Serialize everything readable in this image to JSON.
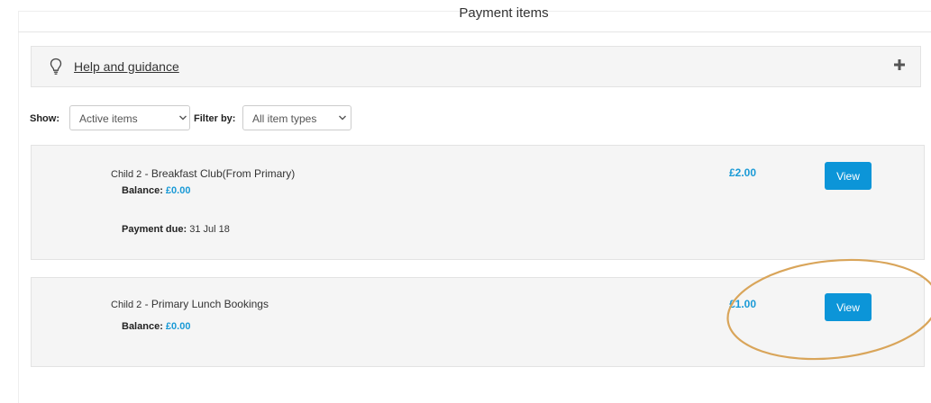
{
  "page": {
    "title": "Payment items"
  },
  "help": {
    "icon": "lightbulb-icon",
    "label": "Help and guidance",
    "expand_icon": "plus-icon"
  },
  "filters": {
    "show_label": "Show:",
    "show_value": "Active items",
    "filter_label": "Filter by:",
    "filter_value": "All item types"
  },
  "items": [
    {
      "child": "Child 2",
      "separator": " - ",
      "name": "Breakfast Club(From Primary)",
      "balance_label": "Balance:",
      "balance_value": "£0.00",
      "due_label": "Payment due:",
      "due_value": "31 Jul 18",
      "amount": "£2.00",
      "button_label": "View"
    },
    {
      "child": "Child 2",
      "separator": " - ",
      "name": "Primary Lunch Bookings",
      "balance_label": "Balance:",
      "balance_value": "£0.00",
      "amount": "£1.00",
      "button_label": "View"
    }
  ],
  "colors": {
    "accent": "#1a9ad6",
    "button": "#0c95d8",
    "panel": "#f5f5f5",
    "annotation": "#d9a55a"
  }
}
